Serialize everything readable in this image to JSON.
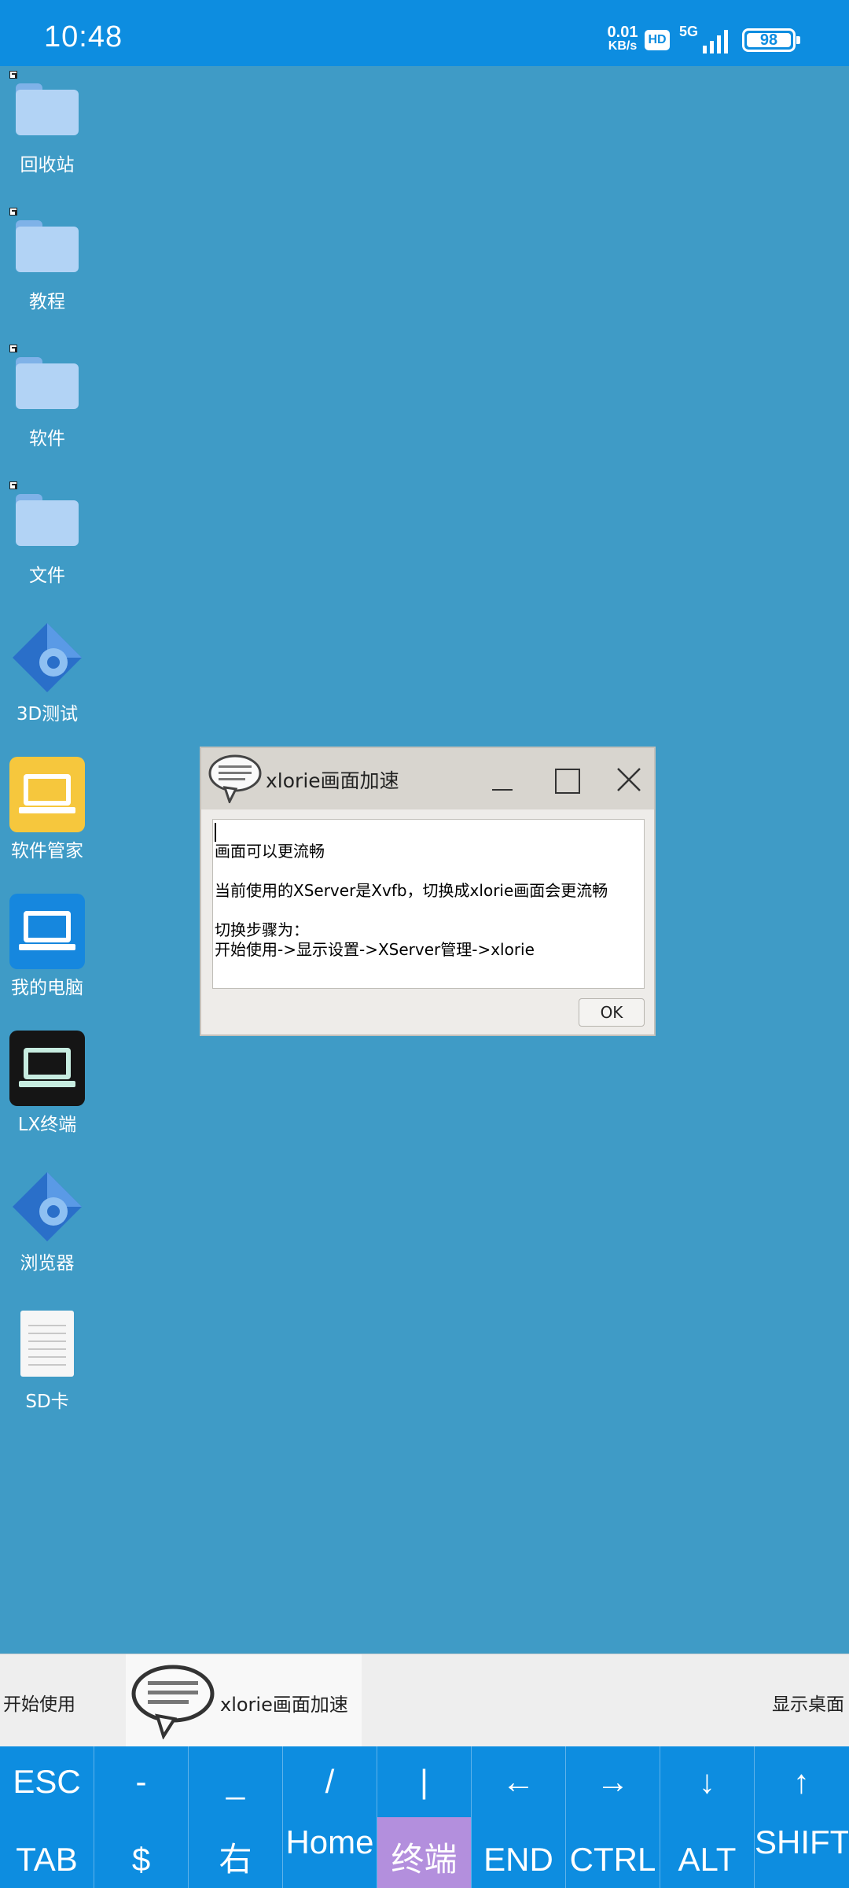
{
  "status_bar": {
    "time": "10:48",
    "net_speed_value": "0.01",
    "net_speed_unit": "KB/s",
    "hd_badge": "HD",
    "network_type": "5G",
    "battery": "98"
  },
  "desktop": {
    "icons": [
      {
        "label": "回收站",
        "icon": "folder-icon"
      },
      {
        "label": "教程",
        "icon": "folder-icon"
      },
      {
        "label": "软件",
        "icon": "folder-icon"
      },
      {
        "label": "文件",
        "icon": "folder-icon"
      },
      {
        "label": "3D测试",
        "icon": "gear-diamond-icon"
      },
      {
        "label": "软件管家",
        "icon": "laptop-icon"
      },
      {
        "label": "我的电脑",
        "icon": "laptop-icon"
      },
      {
        "label": "LX终端",
        "icon": "laptop-icon"
      },
      {
        "label": "浏览器",
        "icon": "gear-diamond-icon"
      },
      {
        "label": "SD卡",
        "icon": "document-icon"
      }
    ]
  },
  "dialog": {
    "title": "xlorie画面加速",
    "lines": [
      "画面可以更流畅",
      "当前使用的XServer是Xvfb，切换成xlorie画面会更流畅",
      "切换步骤为：",
      "开始使用->显示设置->XServer管理->xlorie"
    ],
    "ok_label": "OK"
  },
  "taskbar": {
    "start_label": "开始使用",
    "task_label": "xlorie画面加速",
    "show_desktop_label": "显示桌面"
  },
  "extra_keys": {
    "row1": [
      "ESC",
      "-",
      "_",
      "/",
      "|",
      "←",
      "→",
      "↓",
      "↑"
    ],
    "row2": [
      "TAB",
      "$",
      "右",
      "Home",
      "终端",
      "END",
      "CTRL",
      "ALT",
      "SHIFT"
    ],
    "active_key": "终端"
  },
  "colors": {
    "desktop_bg": "#3f9bc6",
    "status_bar_bg": "#0d8de0",
    "key_active": "#b38fdd"
  }
}
